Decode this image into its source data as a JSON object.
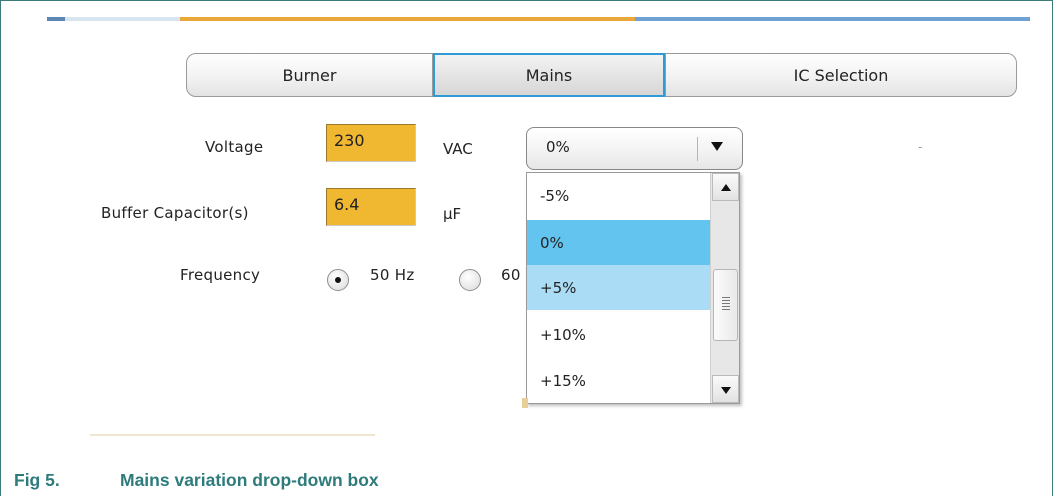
{
  "tabs": [
    {
      "label": "Burner",
      "active": false
    },
    {
      "label": "Mains",
      "active": true
    },
    {
      "label": "IC Selection",
      "active": false
    }
  ],
  "form": {
    "voltage": {
      "label": "Voltage",
      "value": "230",
      "unit": "VAC"
    },
    "buffer_capacitor": {
      "label": "Buffer Capacitor(s)",
      "value": "6.4",
      "unit": "μF"
    },
    "frequency": {
      "label": "Frequency",
      "options": [
        {
          "label": "50 Hz",
          "selected": true
        },
        {
          "label": "60",
          "selected": false
        }
      ]
    }
  },
  "variation_dropdown": {
    "selected_value": "0%",
    "options": [
      {
        "label": "-5%",
        "state": "normal"
      },
      {
        "label": "0%",
        "state": "selected"
      },
      {
        "label": "+5%",
        "state": "hover"
      },
      {
        "label": "+10%",
        "state": "normal"
      },
      {
        "label": "+15%",
        "state": "normal"
      }
    ]
  },
  "caption": {
    "number": "Fig 5.",
    "text": "Mains variation drop-down box"
  },
  "colors": {
    "field_bg": "#f0b731",
    "active_tab_border": "#2f9ad3",
    "selected_option": "#63c4ef",
    "hover_option": "#abdcf5",
    "caption": "#2d7b7b"
  }
}
